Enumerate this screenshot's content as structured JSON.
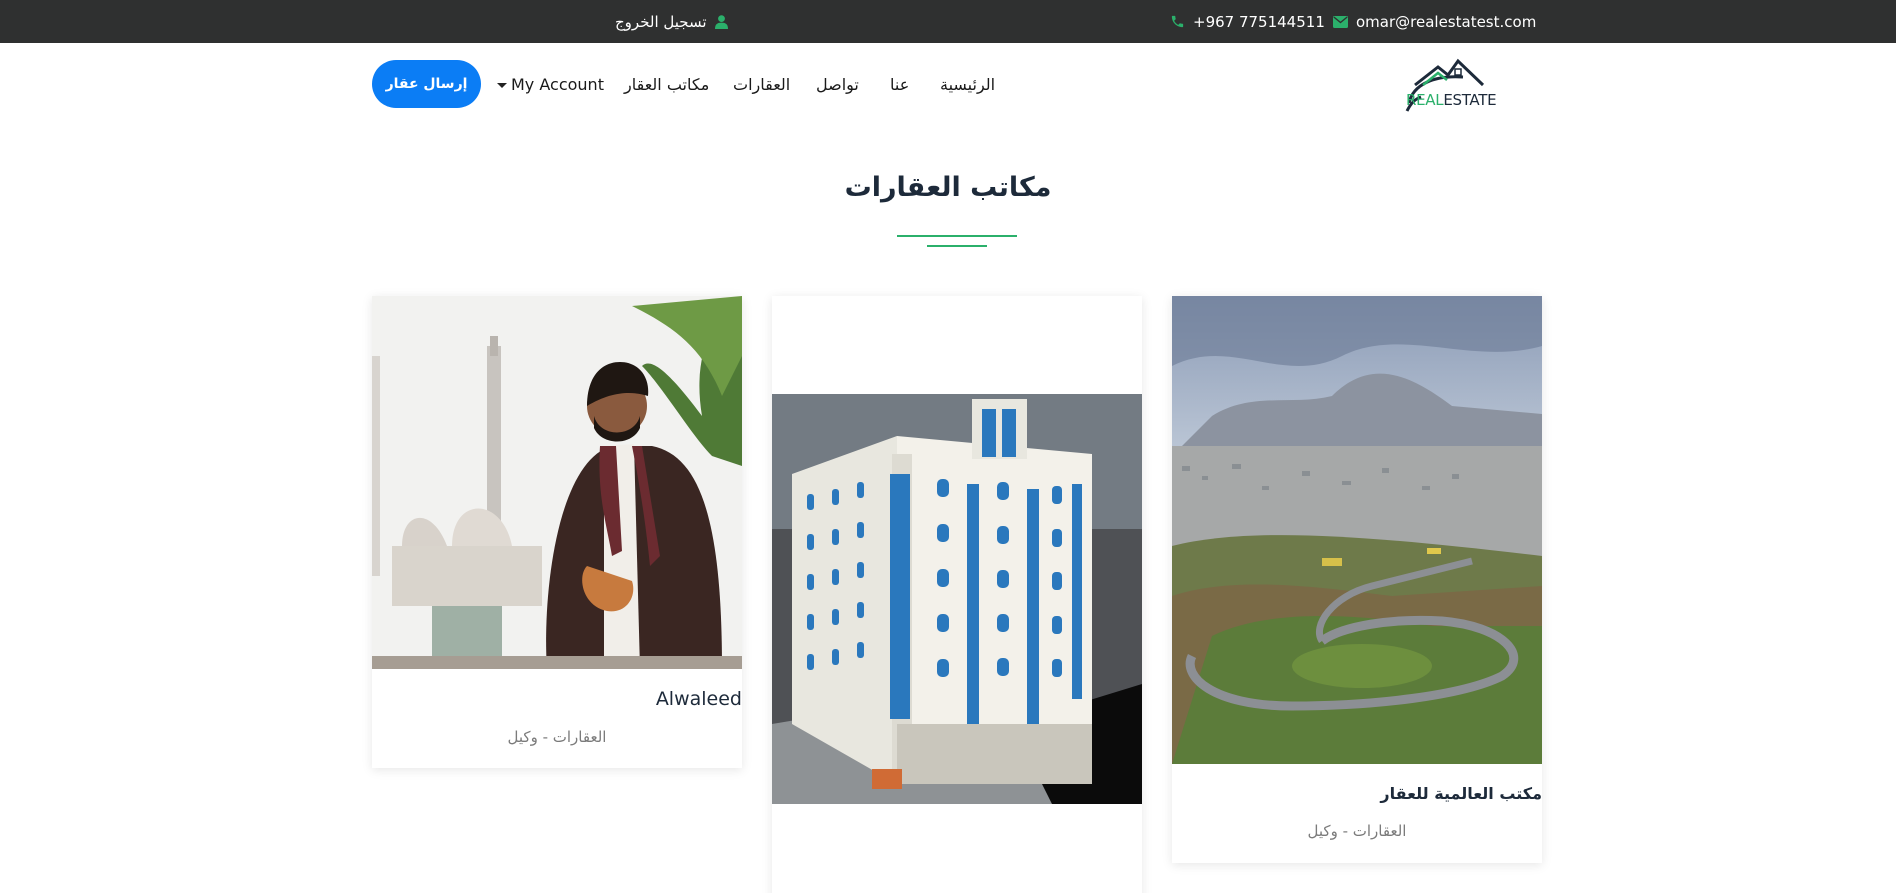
{
  "topbar": {
    "email": "omar@realestatest.com",
    "phone": "+967 775144511",
    "logout_label": "تسجيل الخروج",
    "icon_color": "#2bb06b",
    "background": "#2f3030"
  },
  "logo": {
    "text_green": "REAL",
    "text_dark": "ESTATE"
  },
  "nav": {
    "home": "الرئيسية",
    "about": "عنا",
    "contact": "تواصل",
    "properties": "العقارات",
    "offices": "مكاتب العقار",
    "account": "My Account",
    "submit_button": "إرسال عقار",
    "button_color": "#0b7df5"
  },
  "section": {
    "title": "مكاتب العقارات",
    "accent_color": "#2bb06b"
  },
  "cards": [
    {
      "name": "مكتب العالمية للعقار",
      "role": "العقارات - وكيل",
      "image": "mountain-road-landscape"
    },
    {
      "name": "",
      "role": "",
      "image": "apartment-building-render"
    },
    {
      "name": "Alwaleed",
      "role": "العقارات - وكيل",
      "image": "portrait-man-mosque"
    }
  ]
}
